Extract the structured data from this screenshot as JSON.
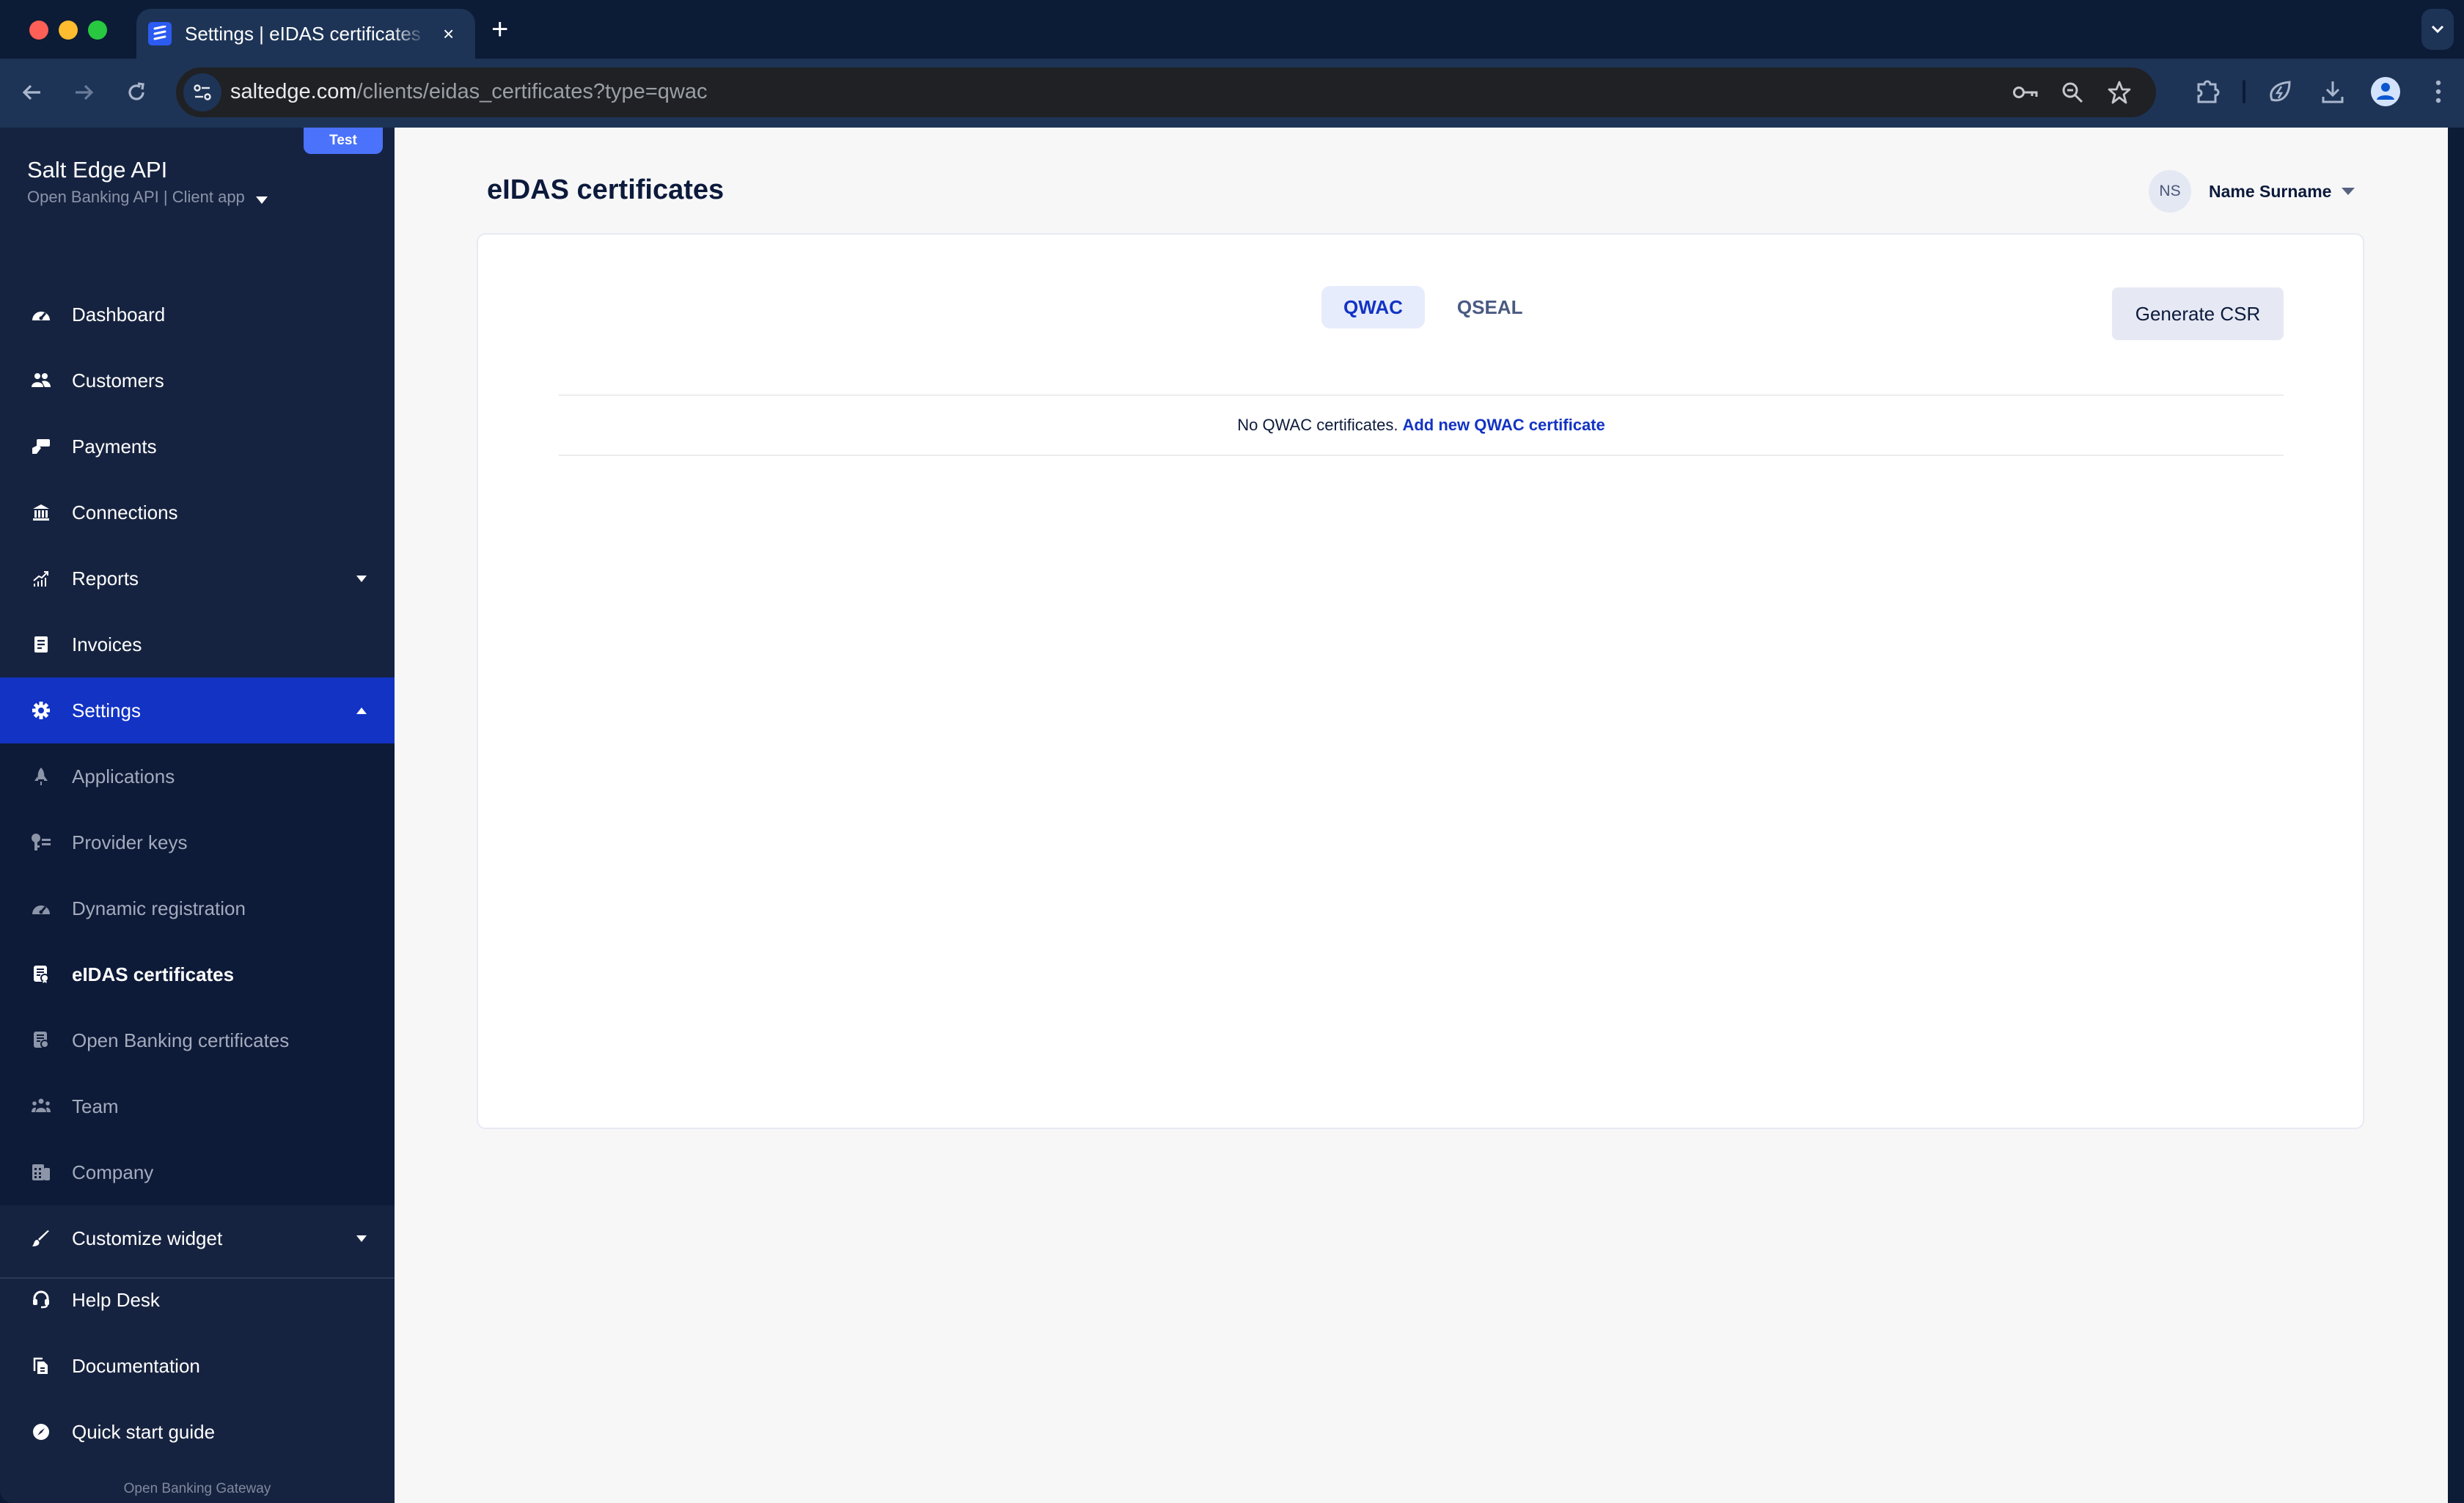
{
  "browser": {
    "tab_title": "Settings | eIDAS certificates",
    "tab_close": "×",
    "new_tab": "+",
    "url_domain": "saltedge.com",
    "url_path": "/clients/eidas_certificates?type=qwac",
    "icons": [
      "key-icon",
      "zoom-out-icon",
      "star-icon",
      "extensions-icon",
      "performance-icon",
      "download-icon",
      "profile-icon",
      "kebab-menu-icon"
    ]
  },
  "sidebar": {
    "badge": "Test",
    "app_name": "Salt Edge API",
    "app_subtitle": "Open Banking API | Client app",
    "items": [
      {
        "label": "Dashboard",
        "icon": "dashboard-icon"
      },
      {
        "label": "Customers",
        "icon": "customers-icon"
      },
      {
        "label": "Payments",
        "icon": "payments-icon"
      },
      {
        "label": "Connections",
        "icon": "bank-icon"
      },
      {
        "label": "Reports",
        "icon": "reports-icon",
        "expandable": true
      },
      {
        "label": "Invoices",
        "icon": "invoice-icon"
      },
      {
        "label": "Settings",
        "icon": "gear-icon",
        "expandable": true,
        "expanded": true,
        "active": true
      }
    ],
    "settings_children": [
      {
        "label": "Applications",
        "icon": "rocket-icon"
      },
      {
        "label": "Provider keys",
        "icon": "key-list-icon"
      },
      {
        "label": "Dynamic registration",
        "icon": "gauge-icon"
      },
      {
        "label": "eIDAS certificates",
        "icon": "certificate-icon",
        "current": true
      },
      {
        "label": "Open Banking certificates",
        "icon": "certificate-icon"
      },
      {
        "label": "Team",
        "icon": "team-icon"
      },
      {
        "label": "Company",
        "icon": "building-icon"
      }
    ],
    "customize": {
      "label": "Customize widget",
      "icon": "brush-icon"
    },
    "bottom_items": [
      {
        "label": "Help Desk",
        "icon": "headset-icon"
      },
      {
        "label": "Documentation",
        "icon": "documents-icon"
      },
      {
        "label": "Quick start guide",
        "icon": "compass-icon"
      }
    ],
    "footer": "Open Banking Gateway"
  },
  "header": {
    "title": "eIDAS certificates",
    "user_initials": "NS",
    "user_name": "Name Surname"
  },
  "content": {
    "tabs": [
      {
        "label": "QWAC",
        "active": true
      },
      {
        "label": "QSEAL",
        "active": false
      }
    ],
    "generate_csr": "Generate CSR",
    "empty_text": "No QWAC certificates.",
    "empty_link": "Add new QWAC certificate"
  },
  "colors": {
    "sidebar_bg": "#162340",
    "active_item": "#1233c4",
    "badge": "#4a72fb",
    "link": "#1233c4"
  }
}
